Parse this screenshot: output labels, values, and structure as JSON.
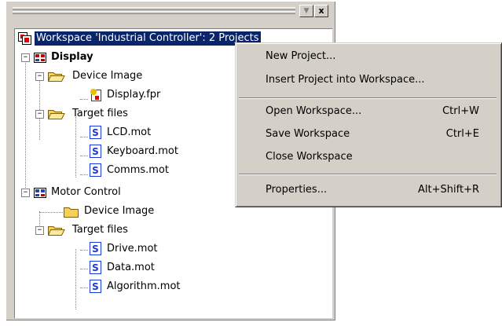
{
  "window": {
    "dock_symbol": "▼",
    "close_symbol": "x"
  },
  "tree": {
    "workspace": "Workspace 'Industrial Controller': 2 Projects",
    "projects": [
      {
        "name": "Display",
        "folders": [
          {
            "name": "Device Image",
            "files": [
              "Display.fpr"
            ]
          },
          {
            "name": "Target files",
            "files": [
              "LCD.mot",
              "Keyboard.mot",
              "Comms.mot"
            ]
          }
        ]
      },
      {
        "name": "Motor Control",
        "folders": [
          {
            "name": "Device Image",
            "files": []
          },
          {
            "name": "Target files",
            "files": [
              "Drive.mot",
              "Data.mot",
              "Algorithm.mot"
            ]
          }
        ]
      }
    ],
    "expander_symbol": "−"
  },
  "context_menu": {
    "items": [
      {
        "label": "New Project...",
        "shortcut": ""
      },
      {
        "label": "Insert Project into Workspace...",
        "shortcut": ""
      },
      {
        "label": "Open Workspace...",
        "shortcut": "Ctrl+W"
      },
      {
        "label": "Save Workspace",
        "shortcut": "Ctrl+E"
      },
      {
        "label": "Close Workspace",
        "shortcut": ""
      },
      {
        "label": "Properties...",
        "shortcut": "Alt+Shift+R"
      }
    ]
  },
  "colors": {
    "selection": "#0a246a",
    "face": "#d4d0c8",
    "folder": "#f2d25a",
    "file_icon": "#1a3ad8"
  }
}
